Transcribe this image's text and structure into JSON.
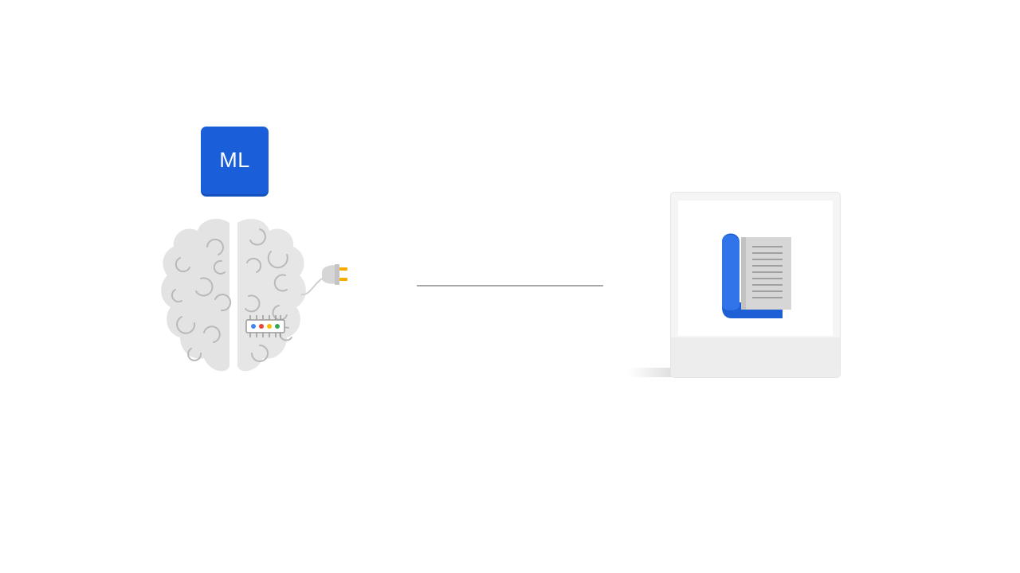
{
  "badge": {
    "label": "ML"
  },
  "icons": {
    "brain": "brain-icon",
    "plug": "plug-icon",
    "chip": "chip-icon",
    "document": "document-icon"
  },
  "colors": {
    "badge": "#1a5fd9",
    "brain": "#e3e3e3",
    "brain_lines": "#b9b9b9",
    "chip_dots": [
      "#4285f4",
      "#ea4335",
      "#fbbc04",
      "#34a853"
    ],
    "plug_prongs": "#f9ab00",
    "doc_blue": "#3173e8",
    "connector": "#a8a8a8"
  }
}
